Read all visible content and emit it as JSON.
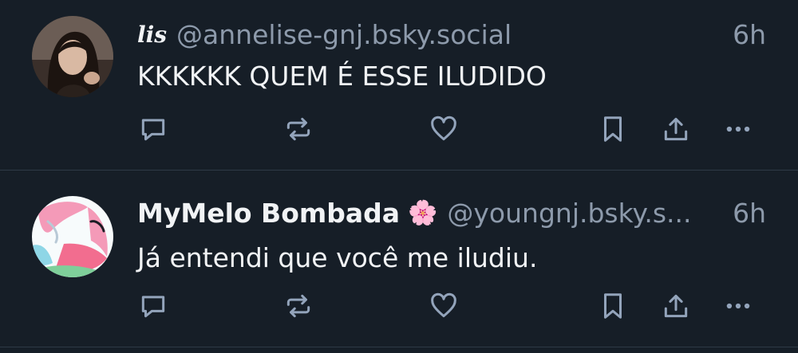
{
  "posts": [
    {
      "display_name": "lis",
      "handle": "@annelise-gnj.bsky.social",
      "time": "6h",
      "text": "KKKKKK QUEM É ESSE ILUDIDO"
    },
    {
      "display_name": "MyMelo Bombada",
      "emoji": "🌸",
      "handle": "@youngnj.bsky.s...",
      "time": "6h",
      "text": "Já entendi que você me iludiu."
    }
  ],
  "icons": [
    "reply-icon",
    "repost-icon",
    "like-icon",
    "bookmark-icon",
    "share-icon",
    "more-icon"
  ],
  "colors": {
    "background": "#161e27",
    "text": "#f1f3f5",
    "muted": "#8d9aab",
    "icon": "#93a4bb",
    "divider": "#2e3a46"
  }
}
